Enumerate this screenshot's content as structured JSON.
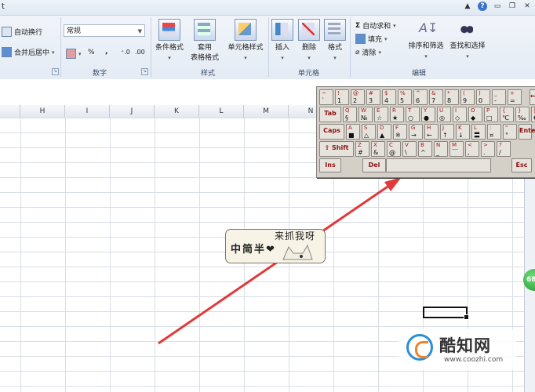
{
  "window": {
    "title_fragment": "t",
    "help": "?"
  },
  "ribbon": {
    "alignment": {
      "wrap_text": "自动换行",
      "merge_center": "合并后居中"
    },
    "number": {
      "format_value": "常规",
      "percent": "%",
      "comma": ",",
      "increase_decimal": ".00→.0",
      "decrease_decimal": ".00",
      "group_label": "数字"
    },
    "styles": {
      "conditional_format": "条件格式",
      "format_as_table_1": "套用",
      "format_as_table_2": "表格格式",
      "cell_styles": "单元格样式",
      "group_label": "样式"
    },
    "cells": {
      "insert": "插入",
      "delete": "删除",
      "format": "格式",
      "group_label": "单元格"
    },
    "editing": {
      "autosum": "自动求和",
      "fill": "填充",
      "clear": "清除",
      "sort_filter": "排序和筛选",
      "find_select": "查找和选择",
      "group_label": "编辑"
    }
  },
  "sheet": {
    "columns": [
      "H",
      "I",
      "J",
      "K",
      "L",
      "M",
      "N"
    ],
    "side_badge": "68"
  },
  "keyboard": {
    "row1": [
      [
        "~",
        "`"
      ],
      [
        "!",
        "1"
      ],
      [
        "@",
        "2"
      ],
      [
        "#",
        "3"
      ],
      [
        "$",
        "4"
      ],
      [
        "%",
        "5"
      ],
      [
        "^",
        "6"
      ],
      [
        "&",
        "7"
      ],
      [
        "*",
        "8"
      ],
      [
        "(",
        "9"
      ],
      [
        ")",
        "0"
      ],
      [
        "_",
        "-"
      ],
      [
        "+",
        "="
      ]
    ],
    "row1_back": "←",
    "row2_tab": "Tab",
    "row2": [
      [
        "Q",
        "§"
      ],
      [
        "W",
        "№"
      ],
      [
        "E",
        "☆"
      ],
      [
        "R",
        "★"
      ],
      [
        "T",
        "○"
      ],
      [
        "Y",
        "●"
      ],
      [
        "U",
        "◎"
      ],
      [
        "I",
        "◇"
      ],
      [
        "O",
        "◆"
      ],
      [
        "P",
        "□"
      ],
      [
        "{",
        "℃"
      ],
      [
        "}",
        "‰"
      ],
      [
        "|",
        "€"
      ]
    ],
    "row3_caps": "Caps",
    "row3": [
      [
        "A",
        "■"
      ],
      [
        "S",
        "△"
      ],
      [
        "D",
        "▲"
      ],
      [
        "F",
        "※"
      ],
      [
        "G",
        "→"
      ],
      [
        "H",
        "←"
      ],
      [
        "J",
        "↑"
      ],
      [
        "K",
        "↓"
      ],
      [
        "L",
        "〓"
      ],
      [
        ":",
        "¤"
      ],
      [
        "\"",
        "°"
      ]
    ],
    "row3_enter": "Enter",
    "row4_shift": "Shift",
    "row4": [
      [
        "Z",
        "#"
      ],
      [
        "X",
        "&"
      ],
      [
        "C",
        "@"
      ],
      [
        "V",
        "\\"
      ],
      [
        "B",
        "^"
      ],
      [
        "N",
        "_"
      ],
      [
        "M",
        "￣"
      ],
      [
        "<",
        ","
      ],
      [
        ">",
        "."
      ],
      [
        "?",
        "/"
      ]
    ],
    "row5_ins": "Ins",
    "row5_del": "Del",
    "row5_esc": "Esc"
  },
  "ime": {
    "mode": "中简半",
    "heart": "❤",
    "catch_text": "来抓我呀"
  },
  "watermark": {
    "name": "酷知网",
    "url": "www.coozhi.com"
  },
  "colors": {
    "arrow": "#e03a3a",
    "keyboard_bg": "#d4d0c8",
    "key_label": "#8b1010"
  }
}
